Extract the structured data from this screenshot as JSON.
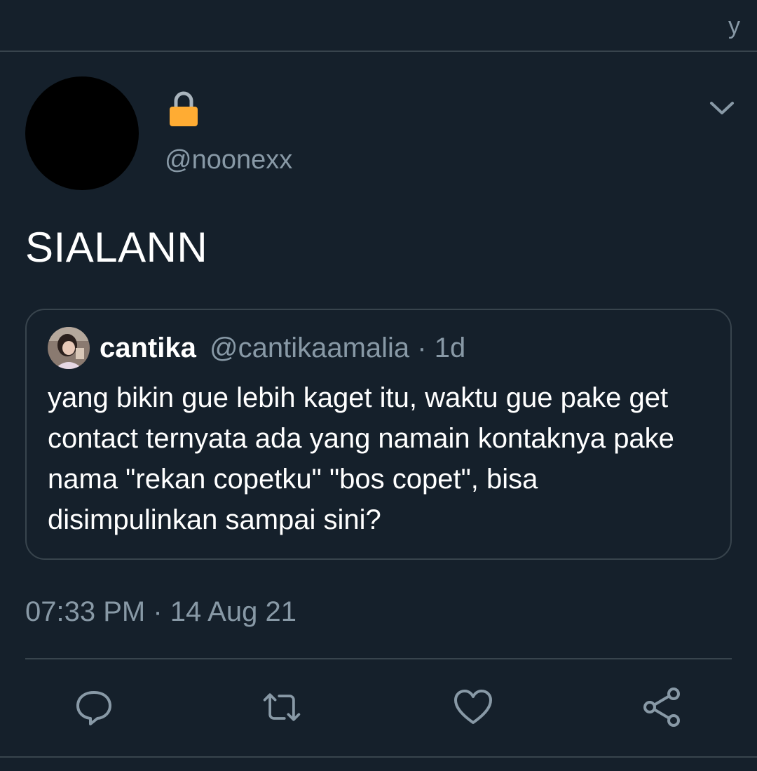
{
  "topbar": {
    "corner_glyph": "y"
  },
  "tweet": {
    "author_name_icon": "lock-icon",
    "handle": "@noonexx",
    "text": "SIALANN",
    "timestamp": "07:33 PM · 14 Aug 21"
  },
  "quote": {
    "name": "cantika",
    "handle": "@cantikaamalia",
    "dot": "·",
    "time": "1d",
    "text": "yang bikin gue lebih kaget itu, waktu gue pake get contact ternyata ada yang namain kontaknya pake nama \"rekan copetku\" \"bos copet\", bisa disimpulinkan sampai sini?"
  },
  "actions": [
    {
      "icon": "reply-icon"
    },
    {
      "icon": "retweet-icon"
    },
    {
      "icon": "like-icon"
    },
    {
      "icon": "share-icon"
    }
  ],
  "colors": {
    "background": "#15202b",
    "border": "#38444d",
    "secondary_text": "#8899a6",
    "primary_text": "#ffffff",
    "lock": "#ffac33"
  }
}
